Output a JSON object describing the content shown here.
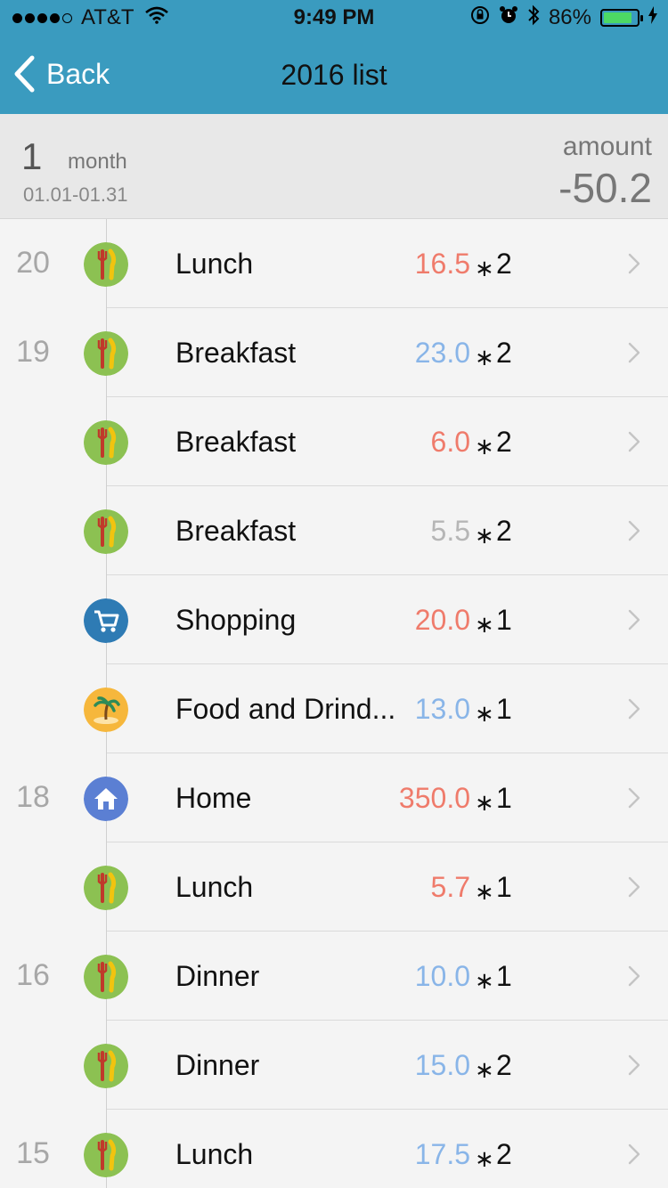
{
  "status_bar": {
    "carrier": "AT&T",
    "time": "9:49 PM",
    "battery": "86%",
    "battery_level": 0.86
  },
  "nav": {
    "back_label": "Back",
    "title": "2016 list"
  },
  "summary": {
    "month_number": "1",
    "month_word": "month",
    "date_range": "01.01-01.31",
    "amount_label": "amount",
    "amount_value": "-50.2"
  },
  "colors": {
    "header": "#3a9bbf",
    "red_price": "#ef7b6b",
    "blue_price": "#89b5e8",
    "gray_price": "#b6b6b6"
  },
  "entries": [
    {
      "day": "20",
      "icon": "food-icon",
      "label": "Lunch",
      "price": "16.5",
      "price_color": "#ef7b6b",
      "multiplier": "∗",
      "qty": "2"
    },
    {
      "day": "19",
      "icon": "food-icon",
      "label": "Breakfast",
      "price": "23.0",
      "price_color": "#89b5e8",
      "multiplier": "∗",
      "qty": "2"
    },
    {
      "day": "",
      "icon": "food-icon",
      "label": "Breakfast",
      "price": "6.0",
      "price_color": "#ef7b6b",
      "multiplier": "∗",
      "qty": "2"
    },
    {
      "day": "",
      "icon": "food-icon",
      "label": "Breakfast",
      "price": "5.5",
      "price_color": "#b6b6b6",
      "multiplier": "∗",
      "qty": "2"
    },
    {
      "day": "",
      "icon": "shopping-cart-icon",
      "label": "Shopping",
      "price": "20.0",
      "price_color": "#ef7b6b",
      "multiplier": "∗",
      "qty": "1"
    },
    {
      "day": "",
      "icon": "palm-island-icon",
      "label": "Food and Drind...",
      "price": "13.0",
      "price_color": "#89b5e8",
      "multiplier": "∗",
      "qty": "1"
    },
    {
      "day": "18",
      "icon": "home-icon",
      "label": "Home",
      "price": "350.0",
      "price_color": "#ef7b6b",
      "multiplier": "∗",
      "qty": "1"
    },
    {
      "day": "",
      "icon": "food-icon",
      "label": "Lunch",
      "price": "5.7",
      "price_color": "#ef7b6b",
      "multiplier": "∗",
      "qty": "1"
    },
    {
      "day": "16",
      "icon": "food-icon",
      "label": "Dinner",
      "price": "10.0",
      "price_color": "#89b5e8",
      "multiplier": "∗",
      "qty": "1"
    },
    {
      "day": "",
      "icon": "food-icon",
      "label": "Dinner",
      "price": "15.0",
      "price_color": "#89b5e8",
      "multiplier": "∗",
      "qty": "2"
    },
    {
      "day": "15",
      "icon": "food-icon",
      "label": "Lunch",
      "price": "17.5",
      "price_color": "#89b5e8",
      "multiplier": "∗",
      "qty": "2"
    }
  ]
}
